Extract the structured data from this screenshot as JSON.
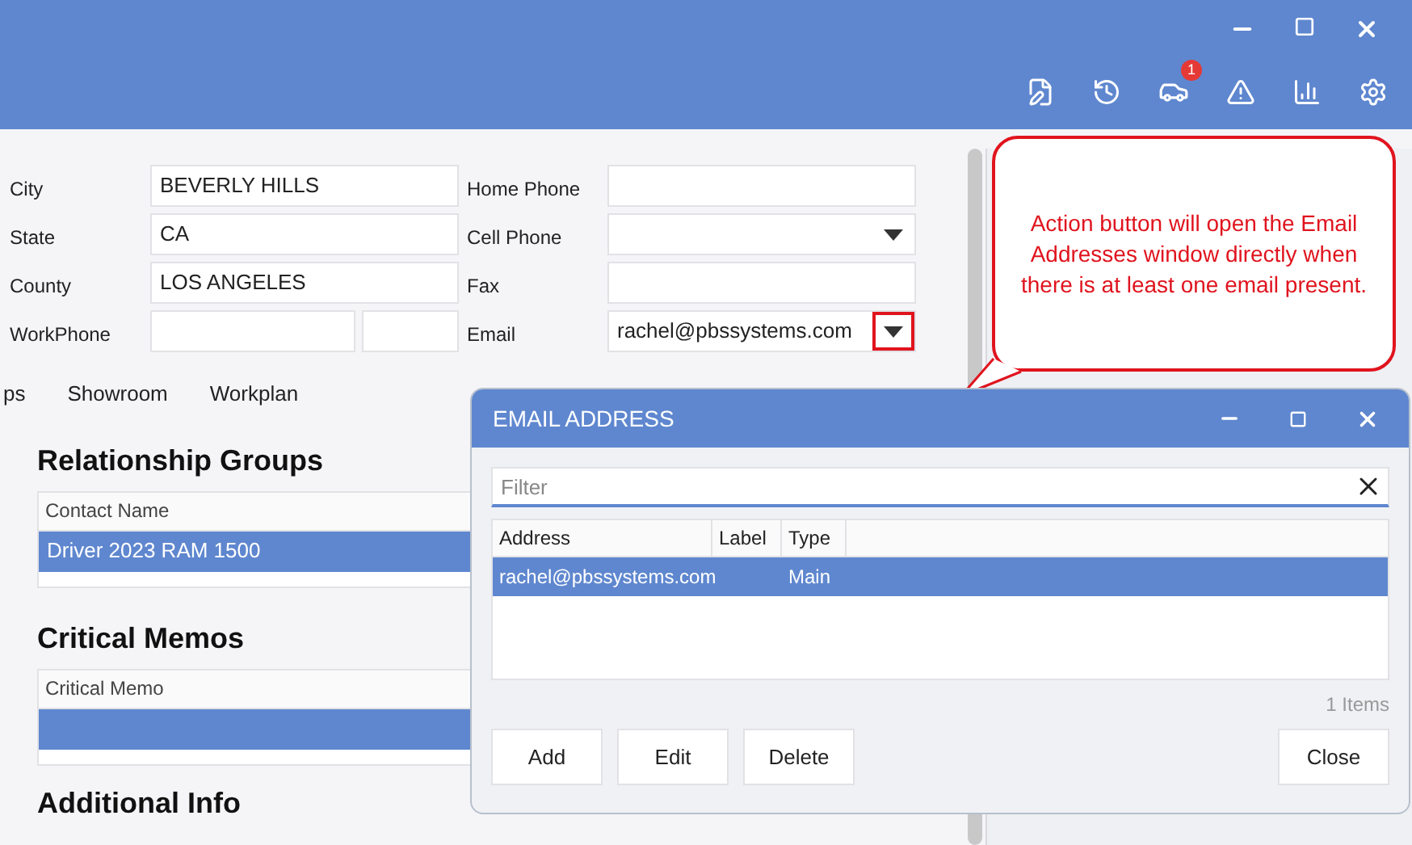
{
  "toolbar": {
    "vehicle_badge": "1"
  },
  "form": {
    "left": [
      {
        "label": "City",
        "kind": "text",
        "value": "BEVERLY HILLS"
      },
      {
        "label": "State",
        "kind": "text",
        "value": "CA"
      },
      {
        "label": "County",
        "kind": "text",
        "value": "LOS ANGELES"
      },
      {
        "label": "WorkPhone",
        "kind": "split"
      }
    ],
    "right": [
      {
        "label": "Home Phone",
        "kind": "text"
      },
      {
        "label": "Cell Phone",
        "kind": "dropdown",
        "highlighted": false
      },
      {
        "label": "Fax",
        "kind": "text"
      },
      {
        "label": "Email",
        "kind": "dropdown",
        "value": "rachel@pbssystems.com",
        "highlighted": true
      }
    ]
  },
  "tabs": [
    {
      "label": "ps"
    },
    {
      "label": "Showroom"
    },
    {
      "label": "Workplan"
    }
  ],
  "sections": [
    {
      "title": "Relationship Groups",
      "column": "Contact Name",
      "rows": [
        {
          "text": "Driver 2023 RAM 1500",
          "selected": true
        }
      ]
    },
    {
      "title": "Critical Memos",
      "column": "Critical Memo",
      "rows": [
        {
          "selected": true
        }
      ]
    },
    {
      "title": "Additional Info"
    }
  ],
  "callout": {
    "text": "Action button will open the Email Addresses window directly when there is at least one email present."
  },
  "dialog": {
    "title": "EMAIL ADDRESS",
    "filter": {
      "placeholder": "Filter"
    },
    "columns": [
      "Address",
      "Label",
      "Type"
    ],
    "rows": [
      {
        "address": "rachel@pbssystems.com",
        "type": "Main",
        "selected": true
      }
    ],
    "count": "1 Items",
    "buttons": [
      "Add",
      "Edit",
      "Delete"
    ],
    "close_button": "Close"
  }
}
